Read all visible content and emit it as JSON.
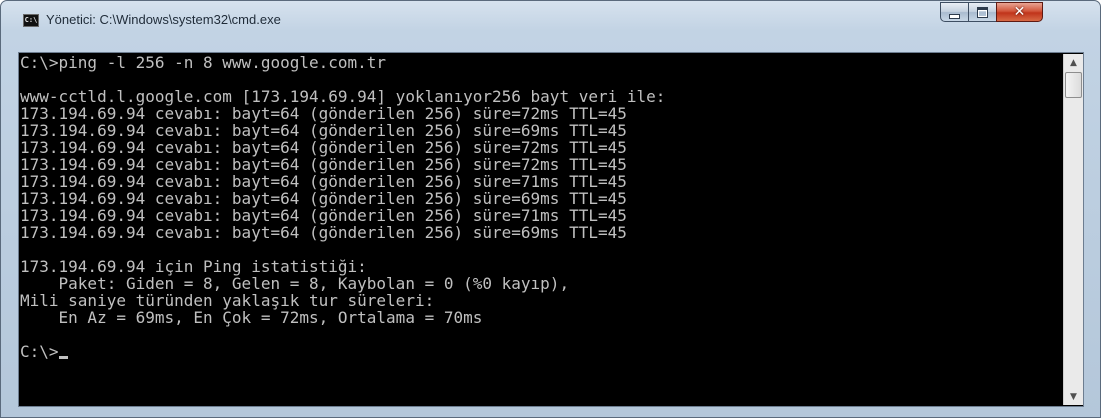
{
  "window": {
    "title": "Yönetici: C:\\Windows\\system32\\cmd.exe",
    "icon_label": "C:\\",
    "controls": {
      "minimize": "minimize",
      "maximize": "maximize",
      "close": "✕"
    }
  },
  "console": {
    "lines": [
      "C:\\>ping -l 256 -n 8 www.google.com.tr",
      "",
      "www-cctld.l.google.com [173.194.69.94] yoklanıyor256 bayt veri ile:",
      "173.194.69.94 cevabı: bayt=64 (gönderilen 256) süre=72ms TTL=45",
      "173.194.69.94 cevabı: bayt=64 (gönderilen 256) süre=69ms TTL=45",
      "173.194.69.94 cevabı: bayt=64 (gönderilen 256) süre=72ms TTL=45",
      "173.194.69.94 cevabı: bayt=64 (gönderilen 256) süre=72ms TTL=45",
      "173.194.69.94 cevabı: bayt=64 (gönderilen 256) süre=71ms TTL=45",
      "173.194.69.94 cevabı: bayt=64 (gönderilen 256) süre=69ms TTL=45",
      "173.194.69.94 cevabı: bayt=64 (gönderilen 256) süre=71ms TTL=45",
      "173.194.69.94 cevabı: bayt=64 (gönderilen 256) süre=69ms TTL=45",
      "",
      "173.194.69.94 için Ping istatistiği:",
      "    Paket: Giden = 8, Gelen = 8, Kaybolan = 0 (%0 kayıp),",
      "Mili saniye türünden yaklaşık tur süreleri:",
      "    En Az = 69ms, En Çok = 72ms, Ortalama = 70ms",
      ""
    ],
    "prompt": "C:\\>"
  },
  "scrollbar": {
    "up_arrow": "▲",
    "down_arrow": "▼"
  },
  "colors": {
    "console_bg": "#000000",
    "console_fg": "#c0c0c0",
    "close_button": "#c7452a"
  }
}
